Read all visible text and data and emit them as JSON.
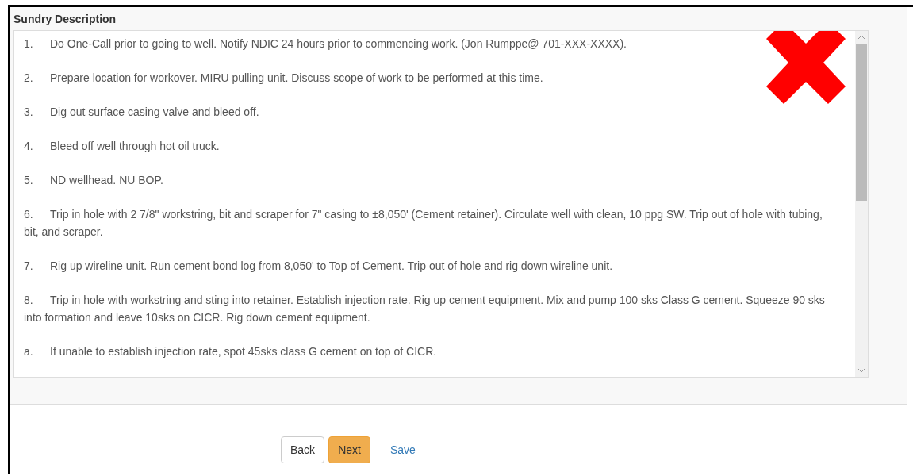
{
  "panel": {
    "title": "Sundry Description",
    "steps": [
      {
        "number": "1.",
        "text": "Do One-Call prior to going to well. Notify NDIC 24 hours prior to commencing work. (Jon Rumppe@ 701-XXX-XXXX)."
      },
      {
        "number": "2.",
        "text": "Prepare location for workover. MIRU pulling unit. Discuss scope of work to be performed at this time."
      },
      {
        "number": "3.",
        "text": "Dig out surface casing valve and bleed off."
      },
      {
        "number": "4.",
        "text": "Bleed off well through hot oil truck."
      },
      {
        "number": "5.",
        "text": "ND wellhead. NU BOP."
      },
      {
        "number": "6.",
        "text": "Trip in hole with 2 7/8\" workstring, bit and scraper for 7\" casing to ±8,050' (Cement retainer). Circulate well with clean, 10 ppg SW. Trip out of hole with tubing, bit, and scraper."
      },
      {
        "number": "7.",
        "text": "Rig up wireline unit. Run cement bond log from 8,050' to Top of Cement. Trip out of hole and rig down wireline unit."
      },
      {
        "number": "8.",
        "text": "Trip in hole with workstring and sting into retainer. Establish injection rate. Rig up cement equipment. Mix and pump 100 sks Class G cement. Squeeze 90 sks into formation and leave 10sks on CICR. Rig down cement equipment."
      },
      {
        "number": "a.",
        "text": "If unable to establish injection rate, spot 45sks class G cement on top of CICR."
      }
    ]
  },
  "buttons": [
    {
      "label": "Back",
      "kind": "default"
    },
    {
      "label": "Next",
      "kind": "primary"
    },
    {
      "label": "Save",
      "kind": "link"
    }
  ]
}
